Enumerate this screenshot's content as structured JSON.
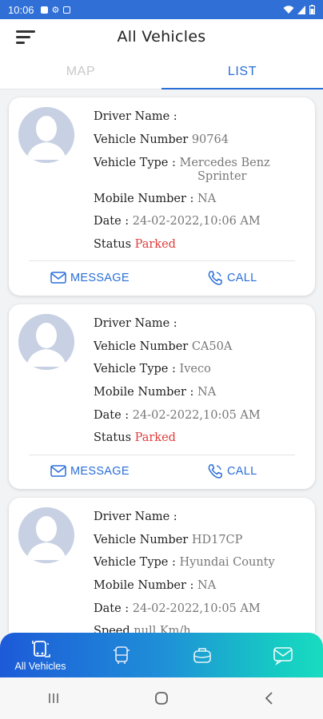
{
  "status_bar": {
    "time": "10:06"
  },
  "header": {
    "title": "All Vehicles"
  },
  "tabs": [
    {
      "label": "MAP",
      "active": false
    },
    {
      "label": "LIST",
      "active": true
    }
  ],
  "labels": {
    "driver_name": "Driver Name :",
    "vehicle_number": "Vehicle Number",
    "vehicle_type": "Vehicle Type :",
    "mobile_number": "Mobile Number :",
    "date": "Date :",
    "status": "Status",
    "speed": "Speed",
    "message": "MESSAGE",
    "call": "CALL"
  },
  "vehicles": [
    {
      "driver_name": "",
      "vehicle_number": "90764",
      "vehicle_type_line1": "Mercedes Benz",
      "vehicle_type_line2": "Sprinter",
      "mobile_number": "NA",
      "date": "24-02-2022,10:06 AM",
      "status": "Parked"
    },
    {
      "driver_name": "",
      "vehicle_number": "CA50A",
      "vehicle_type_line1": "Iveco",
      "mobile_number": "NA",
      "date": "24-02-2022,10:05 AM",
      "status": "Parked"
    },
    {
      "driver_name": "",
      "vehicle_number": "HD17CP",
      "vehicle_type_line1": "Hyundai County",
      "mobile_number": "NA",
      "date": "24-02-2022,10:05 AM",
      "speed_partial": "null Km/h"
    }
  ],
  "bottom_nav": [
    {
      "label": "All Vehicles",
      "icon": "all-vehicles-icon",
      "active": true
    },
    {
      "label": "",
      "icon": "bus-icon",
      "active": false
    },
    {
      "label": "",
      "icon": "briefcase-icon",
      "active": false
    },
    {
      "label": "",
      "icon": "message-icon",
      "active": false
    }
  ],
  "colors": {
    "status_bar": "#2f6fd6",
    "accent": "#2a6ed8",
    "parked": "#e23b3b",
    "nav_gradient_start": "#1d5ad8",
    "nav_gradient_end": "#18dcc0"
  }
}
